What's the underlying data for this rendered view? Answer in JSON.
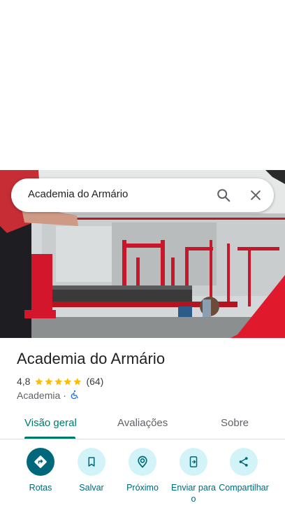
{
  "search": {
    "value": "Academia do Armário",
    "search_icon": "search-icon",
    "close_icon": "close-icon"
  },
  "place": {
    "name": "Academia do Armário",
    "rating": "4,8",
    "rating_stars": 5,
    "review_count": "(64)",
    "category": "Academia",
    "separator": "·",
    "accessibility_icon": "wheelchair-icon"
  },
  "tabs": [
    {
      "label": "Visão geral",
      "active": true
    },
    {
      "label": "Avaliações",
      "active": false
    },
    {
      "label": "Sobre",
      "active": false
    }
  ],
  "actions": [
    {
      "label": "Rotas",
      "icon": "directions-icon"
    },
    {
      "label": "Salvar",
      "icon": "bookmark-icon"
    },
    {
      "label": "Próximo",
      "icon": "nearby-icon"
    },
    {
      "label": "Enviar para o",
      "icon": "send-to-phone-icon"
    },
    {
      "label": "Compartilhar",
      "icon": "share-icon"
    }
  ],
  "colors": {
    "accent": "#00796b",
    "action_primary": "#00687a",
    "action_bg": "#d2f4f9",
    "star": "#fbbc04"
  }
}
